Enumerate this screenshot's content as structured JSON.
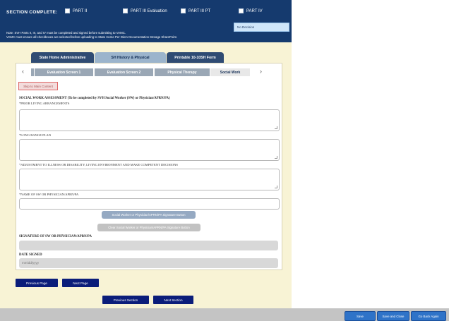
{
  "header": {
    "section_complete": "SECTION COMPLETE:",
    "checkboxes": [
      "PART II",
      "PART III Evaluation",
      "PART III PT",
      "PART IV"
    ],
    "note_line1": "Note: SVH Parts II, III, and IV must be completed and signed before submitting to VAMC.",
    "note_line2": "VAMC must ensure all checkboxes are selected before uploading to State Home Per Diem Documentation Storage SharePoint.",
    "decision_value": "No Decision"
  },
  "main_tabs": [
    "State Home Administrative",
    "SH History & Physical",
    "Printable 10-10SH Form"
  ],
  "sub_tabs": [
    "Evaluation Screen 1",
    "Evaluation Screen 2",
    "Physical Therapy",
    "Social Work"
  ],
  "nav": {
    "prev_arrow": "‹",
    "next_arrow": "›"
  },
  "skip_link": "Skip to Main Content",
  "form": {
    "heading": "SOCIAL WORK ASSESSMENT (To be completed by SVH Social Worker (SW) or Physician/APRN/PA)",
    "prior_living": "*PRIOR LIVING ARRANGEMENTS",
    "long_range": "*LONG RANGE PLAN",
    "adjustment": "*ADJUSTMENT TO ILLNESS OR DISABILITY, LIVING ENVIRONMENT AND MAKE COMPETENT DECISIONS",
    "name_label": "*NAME OF SW OR PHYSICIAN/APRN/PA",
    "sig_button": "Social Worker or Physician/APRN/PA Signature Button",
    "clear_sig_button": "Clear Social Worker or Physician/APRN/PA Signature Button",
    "signature_label": "SIGNATURE OF SW OR PHYSICIAN/APRN/PA",
    "date_label": "DATE SIGNED",
    "date_placeholder": "mm/dd/yyyy"
  },
  "page_nav": {
    "previous_page": "Previous Page",
    "next_page": "Next Page"
  },
  "section_nav": {
    "previous_section": "Previous Section",
    "next_section": "Next Section"
  },
  "footer_buttons": [
    "Save",
    "Save and Close",
    "Go Back Again"
  ]
}
